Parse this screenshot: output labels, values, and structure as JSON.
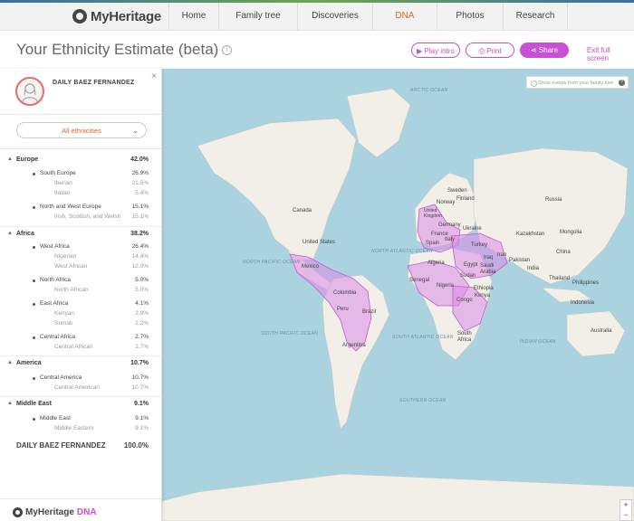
{
  "nav": {
    "logo_text": "MyHeritage",
    "links": [
      {
        "label": "Home",
        "active": false
      },
      {
        "label": "Family tree",
        "active": false
      },
      {
        "label": "Discoveries",
        "active": false
      },
      {
        "label": "DNA",
        "active": true
      },
      {
        "label": "Photos",
        "active": false
      },
      {
        "label": "Research",
        "active": false
      }
    ]
  },
  "header": {
    "title": "Your Ethnicity Estimate (beta)",
    "info_glyph": "i",
    "play_intro_label": "Play intro",
    "play_icon": "▶",
    "print_label": "Print",
    "print_icon": "⎙",
    "share_label": "Share",
    "share_icon": "⋖",
    "exit_label": "Exit full screen"
  },
  "sidebar": {
    "close_glyph": "×",
    "person_name": "DAILY BAEZ FERNANDEZ",
    "ethnicity_select": "All ethnicities",
    "regions": [
      {
        "name": "Europe",
        "pct": "42.0%",
        "subs": [
          {
            "name": "South Europe",
            "pct": "26.9%",
            "items": [
              {
                "name": "Iberian",
                "pct": "21.5%"
              },
              {
                "name": "Italian",
                "pct": "5.4%"
              }
            ]
          },
          {
            "name": "North and West Europe",
            "pct": "15.1%",
            "items": [
              {
                "name": "Irish, Scottish, and Welsh",
                "pct": "15.1%"
              }
            ]
          }
        ]
      },
      {
        "name": "Africa",
        "pct": "38.2%",
        "subs": [
          {
            "name": "West Africa",
            "pct": "26.4%",
            "items": [
              {
                "name": "Nigerian",
                "pct": "14.4%"
              },
              {
                "name": "West African",
                "pct": "12.0%"
              }
            ]
          },
          {
            "name": "North Africa",
            "pct": "5.0%",
            "items": [
              {
                "name": "North African",
                "pct": "5.0%"
              }
            ]
          },
          {
            "name": "East Africa",
            "pct": "4.1%",
            "items": [
              {
                "name": "Kenyan",
                "pct": "2.9%"
              },
              {
                "name": "Somali",
                "pct": "1.2%"
              }
            ]
          },
          {
            "name": "Central Africa",
            "pct": "2.7%",
            "items": [
              {
                "name": "Central African",
                "pct": "2.7%"
              }
            ]
          }
        ]
      },
      {
        "name": "America",
        "pct": "10.7%",
        "subs": [
          {
            "name": "Central America",
            "pct": "10.7%",
            "items": [
              {
                "name": "Central American",
                "pct": "10.7%"
              }
            ]
          }
        ]
      },
      {
        "name": "Middle East",
        "pct": "9.1%",
        "subs": [
          {
            "name": "Middle East",
            "pct": "9.1%",
            "items": [
              {
                "name": "Middle Eastern",
                "pct": "9.1%"
              }
            ]
          }
        ]
      }
    ],
    "total_name": "DAILY BAEZ FERNANDEZ",
    "total_pct": "100.0%",
    "footer_brand": "MyHeritage",
    "footer_dna": "DNA"
  },
  "map": {
    "family_toggle_label": "Show events from your family tree",
    "zoom_in": "+",
    "zoom_out": "−",
    "oceans": {
      "arctic": "ARCTIC OCEAN",
      "north_pacific": "NORTH PACIFIC OCEAN",
      "north_atlantic": "NORTH ATLANTIC OCEAN",
      "south_pacific": "SOUTH PACIFIC OCEAN",
      "south_atlantic": "SOUTH ATLANTIC OCEAN",
      "indian": "INDIAN OCEAN",
      "southern": "SOUTHERN OCEAN"
    },
    "countries": {
      "canada": "Canada",
      "united_states": "United States",
      "mexico": "Mexico",
      "colombia": "Colombia",
      "peru": "Peru",
      "brazil": "Brazil",
      "argentina": "Argentina",
      "sweden": "Sweden",
      "finland": "Finland",
      "norway": "Norway",
      "russia": "Russia",
      "uk": "United Kingdom",
      "germany": "Germany",
      "ukraine": "Ukraine",
      "france": "France",
      "spain": "Spain",
      "italy": "Italy",
      "turkey": "Turkey",
      "iran": "Iran",
      "iraq": "Iraq",
      "algeria": "Algeria",
      "egypt": "Egypt",
      "saudi_arabia": "Saudi Arabia",
      "pakistan": "Pakistan",
      "india": "India",
      "china": "China",
      "kazakhstan": "Kazakhstan",
      "mongolia": "Mongolia",
      "senegal": "Senegal",
      "nigeria": "Nigeria",
      "sudan": "Sudan",
      "ethiopia": "Ethiopia",
      "congo": "Congo",
      "kenya": "Kenya",
      "south_africa": "South Africa",
      "thailand": "Thailand",
      "philippines": "Philippines",
      "indonesia": "Indonesia",
      "australia": "Australia"
    }
  },
  "colors": {
    "accent": "#c94fd6",
    "nav_active": "#e8621d",
    "ocean": "#aad3df",
    "land": "#f2efe9",
    "overlay": "#d98ae6"
  }
}
